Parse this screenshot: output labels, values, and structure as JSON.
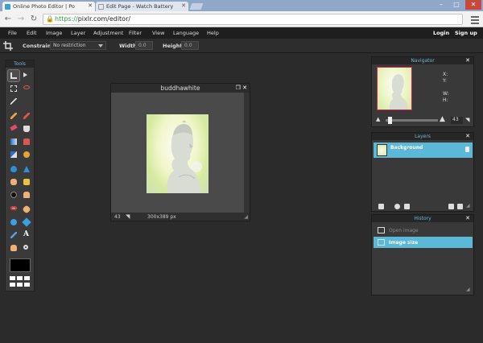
{
  "browser": {
    "tabs": [
      {
        "title": "Online Photo Editor | Po",
        "active": true
      },
      {
        "title": "Edit Page - Watch Battery",
        "active": false
      }
    ],
    "url_scheme": "https://",
    "url_rest": "pixlr.com/editor/"
  },
  "menubar": {
    "items": [
      "File",
      "Edit",
      "Image",
      "Layer",
      "Adjustment",
      "Filter",
      "View",
      "Language",
      "Help"
    ],
    "login": "Login",
    "signup": "Sign up"
  },
  "options": {
    "constraint_label": "Constraint",
    "constraint_value": "No restriction",
    "width_label": "Width",
    "width_value": "0.0",
    "height_label": "Height",
    "height_value": "0.0"
  },
  "tools": {
    "title": "Tools"
  },
  "document": {
    "title": "buddhawhite",
    "zoom": "43",
    "size": "300x389 px"
  },
  "navigator": {
    "title": "Navigator",
    "x_label": "X:",
    "y_label": "Y:",
    "w_label": "W:",
    "h_label": "H:",
    "zoom": "43"
  },
  "layers": {
    "title": "Layers",
    "items": [
      {
        "name": "Background",
        "selected": true
      }
    ]
  },
  "history": {
    "title": "History",
    "items": [
      {
        "label": "Open image",
        "selected": false
      },
      {
        "label": "Image size",
        "selected": true
      }
    ]
  },
  "colors": {
    "accent": "#5bb8d6",
    "panel_title": "#6fb8d3",
    "nav_frame": "#d2234e"
  }
}
